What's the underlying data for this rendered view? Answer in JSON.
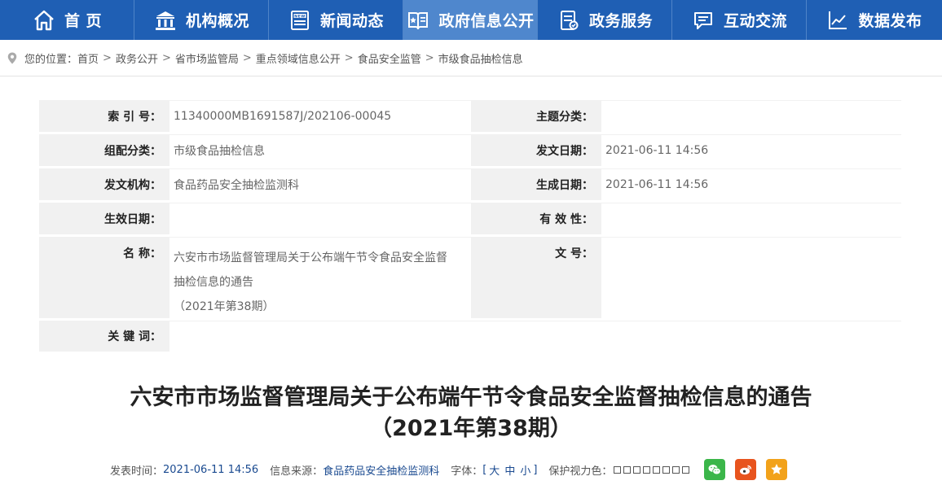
{
  "nav": {
    "items": [
      {
        "label": "首 页",
        "icon": "home-icon"
      },
      {
        "label": "机构概况",
        "icon": "building-icon"
      },
      {
        "label": "新闻动态",
        "icon": "news-icon"
      },
      {
        "label": "政府信息公开",
        "icon": "book-star-icon"
      },
      {
        "label": "政务服务",
        "icon": "service-doc-icon"
      },
      {
        "label": "互动交流",
        "icon": "chat-icon"
      },
      {
        "label": "数据发布",
        "icon": "chart-icon"
      }
    ],
    "active_index": 3
  },
  "breadcrumb": {
    "prefix": "您的位置：",
    "items": [
      "首页",
      "政务公开",
      "省市场监管局",
      "重点领域信息公开",
      "食品安全监管",
      "市级食品抽检信息"
    ],
    "separator": ">"
  },
  "meta": {
    "index_no_label": "索  引  号：",
    "index_no": "11340000MB1691587J/202106-00045",
    "topic_label": "主题分类：",
    "topic": "",
    "category_label": "组配分类：",
    "category": "市级食品抽检信息",
    "issue_date_label": "发文日期：",
    "issue_date": "2021-06-11 14:56",
    "org_label": "发文机构：",
    "org": "食品药品安全抽检监测科",
    "gen_date_label": "生成日期：",
    "gen_date": "2021-06-11 14:56",
    "effective_date_label": "生效日期：",
    "effective_date": "",
    "validity_label": "有  效  性：",
    "validity": "",
    "name_label": "名       称：",
    "name_line1": "六安市市场监督管理局关于公布端午节令食品安全监督",
    "name_line2": "抽检信息的通告",
    "name_line3": "（2021年第38期）",
    "doc_no_label": "文       号：",
    "doc_no": "",
    "keywords_label": "关  键  词：",
    "keywords": ""
  },
  "article": {
    "title_line1": "六安市市场监督管理局关于公布端午节令食品安全监督抽检信息的通告",
    "title_line2": "（2021年第38期）"
  },
  "info": {
    "publish_label": "发表时间：",
    "publish_time": "2021-06-11 14:56",
    "source_label": "信息来源：",
    "source": "食品药品安全抽检监测科",
    "font_label": "字体：",
    "bracket_open": "[",
    "size_large": "大",
    "size_medium": "中",
    "size_small": "小",
    "bracket_close": "]",
    "eye_label": "保护视力色：",
    "swatch_colors": [
      "#ffffff",
      "#ffffff",
      "#ffffff",
      "#ffffff",
      "#ffffff",
      "#ffffff",
      "#ffffff",
      "#ffffff"
    ]
  },
  "colors": {
    "nav_bg": "#1f5fb4",
    "nav_active": "#4f87cd",
    "wechat": "#3bb64a",
    "weibo": "#e8541e",
    "favorite": "#f2a21b"
  }
}
